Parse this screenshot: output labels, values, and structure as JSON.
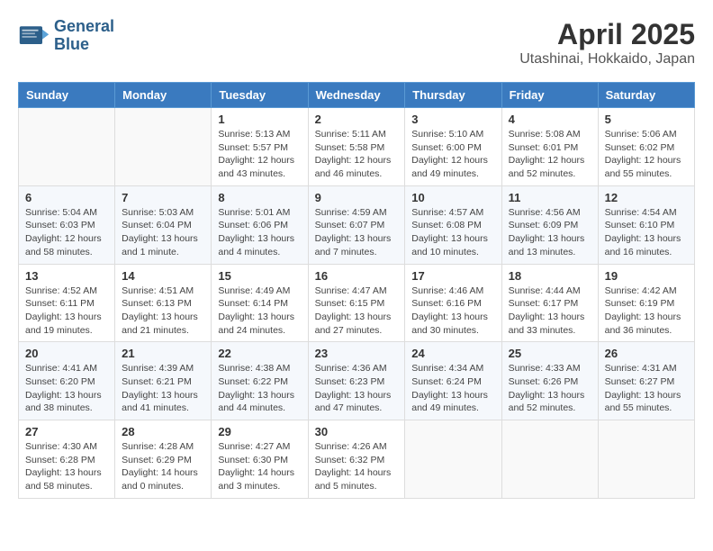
{
  "header": {
    "logo_line1": "General",
    "logo_line2": "Blue",
    "month_year": "April 2025",
    "location": "Utashinai, Hokkaido, Japan"
  },
  "days_of_week": [
    "Sunday",
    "Monday",
    "Tuesday",
    "Wednesday",
    "Thursday",
    "Friday",
    "Saturday"
  ],
  "weeks": [
    [
      {
        "num": "",
        "info": ""
      },
      {
        "num": "",
        "info": ""
      },
      {
        "num": "1",
        "info": "Sunrise: 5:13 AM\nSunset: 5:57 PM\nDaylight: 12 hours\nand 43 minutes."
      },
      {
        "num": "2",
        "info": "Sunrise: 5:11 AM\nSunset: 5:58 PM\nDaylight: 12 hours\nand 46 minutes."
      },
      {
        "num": "3",
        "info": "Sunrise: 5:10 AM\nSunset: 6:00 PM\nDaylight: 12 hours\nand 49 minutes."
      },
      {
        "num": "4",
        "info": "Sunrise: 5:08 AM\nSunset: 6:01 PM\nDaylight: 12 hours\nand 52 minutes."
      },
      {
        "num": "5",
        "info": "Sunrise: 5:06 AM\nSunset: 6:02 PM\nDaylight: 12 hours\nand 55 minutes."
      }
    ],
    [
      {
        "num": "6",
        "info": "Sunrise: 5:04 AM\nSunset: 6:03 PM\nDaylight: 12 hours\nand 58 minutes."
      },
      {
        "num": "7",
        "info": "Sunrise: 5:03 AM\nSunset: 6:04 PM\nDaylight: 13 hours\nand 1 minute."
      },
      {
        "num": "8",
        "info": "Sunrise: 5:01 AM\nSunset: 6:06 PM\nDaylight: 13 hours\nand 4 minutes."
      },
      {
        "num": "9",
        "info": "Sunrise: 4:59 AM\nSunset: 6:07 PM\nDaylight: 13 hours\nand 7 minutes."
      },
      {
        "num": "10",
        "info": "Sunrise: 4:57 AM\nSunset: 6:08 PM\nDaylight: 13 hours\nand 10 minutes."
      },
      {
        "num": "11",
        "info": "Sunrise: 4:56 AM\nSunset: 6:09 PM\nDaylight: 13 hours\nand 13 minutes."
      },
      {
        "num": "12",
        "info": "Sunrise: 4:54 AM\nSunset: 6:10 PM\nDaylight: 13 hours\nand 16 minutes."
      }
    ],
    [
      {
        "num": "13",
        "info": "Sunrise: 4:52 AM\nSunset: 6:11 PM\nDaylight: 13 hours\nand 19 minutes."
      },
      {
        "num": "14",
        "info": "Sunrise: 4:51 AM\nSunset: 6:13 PM\nDaylight: 13 hours\nand 21 minutes."
      },
      {
        "num": "15",
        "info": "Sunrise: 4:49 AM\nSunset: 6:14 PM\nDaylight: 13 hours\nand 24 minutes."
      },
      {
        "num": "16",
        "info": "Sunrise: 4:47 AM\nSunset: 6:15 PM\nDaylight: 13 hours\nand 27 minutes."
      },
      {
        "num": "17",
        "info": "Sunrise: 4:46 AM\nSunset: 6:16 PM\nDaylight: 13 hours\nand 30 minutes."
      },
      {
        "num": "18",
        "info": "Sunrise: 4:44 AM\nSunset: 6:17 PM\nDaylight: 13 hours\nand 33 minutes."
      },
      {
        "num": "19",
        "info": "Sunrise: 4:42 AM\nSunset: 6:19 PM\nDaylight: 13 hours\nand 36 minutes."
      }
    ],
    [
      {
        "num": "20",
        "info": "Sunrise: 4:41 AM\nSunset: 6:20 PM\nDaylight: 13 hours\nand 38 minutes."
      },
      {
        "num": "21",
        "info": "Sunrise: 4:39 AM\nSunset: 6:21 PM\nDaylight: 13 hours\nand 41 minutes."
      },
      {
        "num": "22",
        "info": "Sunrise: 4:38 AM\nSunset: 6:22 PM\nDaylight: 13 hours\nand 44 minutes."
      },
      {
        "num": "23",
        "info": "Sunrise: 4:36 AM\nSunset: 6:23 PM\nDaylight: 13 hours\nand 47 minutes."
      },
      {
        "num": "24",
        "info": "Sunrise: 4:34 AM\nSunset: 6:24 PM\nDaylight: 13 hours\nand 49 minutes."
      },
      {
        "num": "25",
        "info": "Sunrise: 4:33 AM\nSunset: 6:26 PM\nDaylight: 13 hours\nand 52 minutes."
      },
      {
        "num": "26",
        "info": "Sunrise: 4:31 AM\nSunset: 6:27 PM\nDaylight: 13 hours\nand 55 minutes."
      }
    ],
    [
      {
        "num": "27",
        "info": "Sunrise: 4:30 AM\nSunset: 6:28 PM\nDaylight: 13 hours\nand 58 minutes."
      },
      {
        "num": "28",
        "info": "Sunrise: 4:28 AM\nSunset: 6:29 PM\nDaylight: 14 hours\nand 0 minutes."
      },
      {
        "num": "29",
        "info": "Sunrise: 4:27 AM\nSunset: 6:30 PM\nDaylight: 14 hours\nand 3 minutes."
      },
      {
        "num": "30",
        "info": "Sunrise: 4:26 AM\nSunset: 6:32 PM\nDaylight: 14 hours\nand 5 minutes."
      },
      {
        "num": "",
        "info": ""
      },
      {
        "num": "",
        "info": ""
      },
      {
        "num": "",
        "info": ""
      }
    ]
  ]
}
